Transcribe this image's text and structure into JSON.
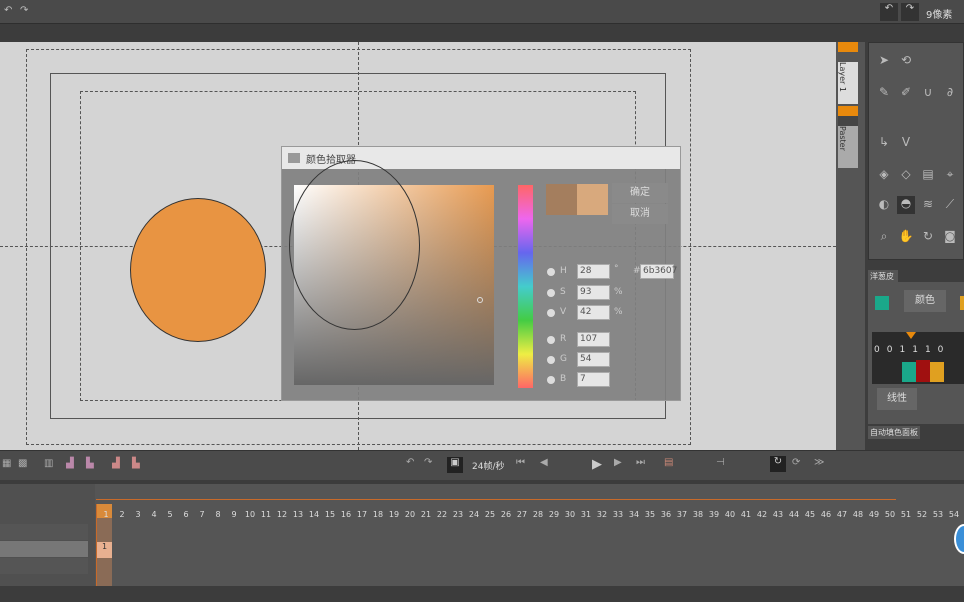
{
  "topbar": {
    "brush_size": "9像素"
  },
  "dialog": {
    "title": "颜色拾取器",
    "ok": "确定",
    "cancel": "取消",
    "fields": [
      {
        "label": "H",
        "value": "28",
        "unit": "°"
      },
      {
        "label": "S",
        "value": "93",
        "unit": "%"
      },
      {
        "label": "V",
        "value": "42",
        "unit": "%"
      },
      {
        "label": "R",
        "value": "107"
      },
      {
        "label": "G",
        "value": "54"
      },
      {
        "label": "B",
        "value": "7"
      }
    ],
    "hex_label": "#",
    "hex": "6b3607",
    "old_color": "#a47e5e",
    "new_color": "#d8a97d"
  },
  "layers": {
    "layer1": "Layer 1",
    "layer2": "Paster"
  },
  "color_panel": {
    "tab": "洋葱皮",
    "mode": "颜色",
    "interp": "线性",
    "frames": [
      "0",
      "0",
      "1",
      "1",
      "1",
      "0"
    ],
    "swatch": "#1aa88a"
  },
  "auto_panel": {
    "tab": "自动填色面板"
  },
  "toolbar": {
    "fps": "24帧/秒"
  },
  "timeline": {
    "frames": [
      "1",
      "2",
      "3",
      "4",
      "5",
      "6",
      "7",
      "8",
      "9",
      "10",
      "11",
      "12",
      "13",
      "14",
      "15",
      "16",
      "17",
      "18",
      "19",
      "20",
      "21",
      "22",
      "23",
      "24",
      "25",
      "26",
      "27",
      "28",
      "29",
      "30",
      "31",
      "32",
      "33",
      "34",
      "35",
      "36",
      "37",
      "38",
      "39",
      "40",
      "41",
      "42",
      "43",
      "44",
      "45",
      "46",
      "47",
      "48",
      "49",
      "50",
      "51",
      "52",
      "53",
      "54"
    ],
    "cell1": "1"
  },
  "colors": {
    "accent": "#e8890c",
    "circle": "#e89442"
  }
}
